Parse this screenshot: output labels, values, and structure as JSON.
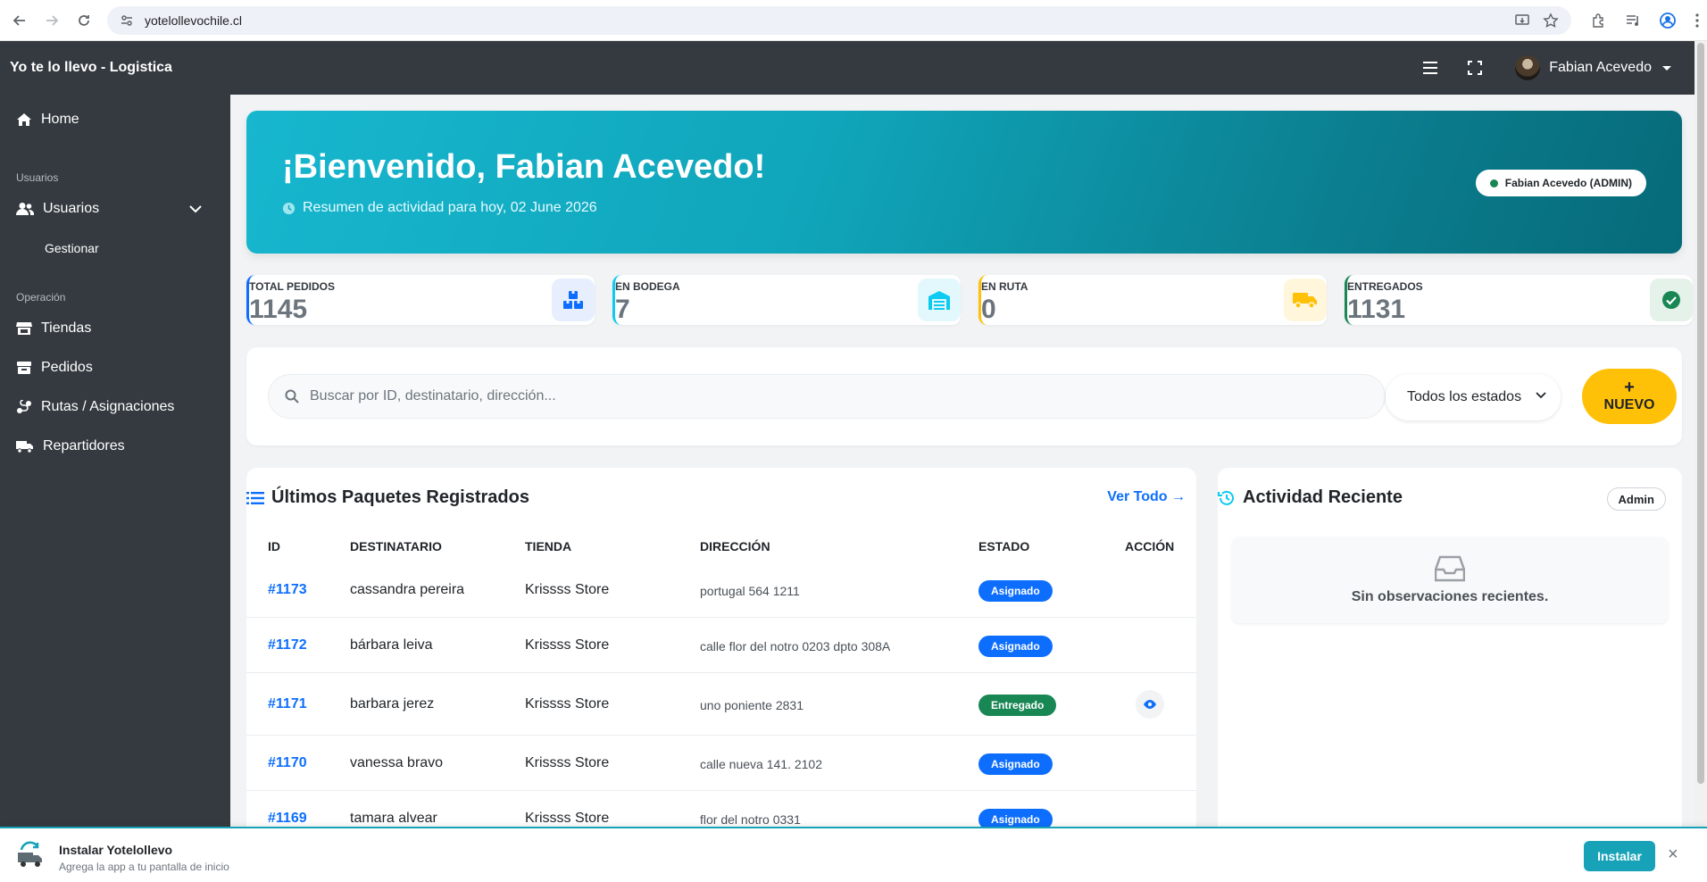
{
  "browser": {
    "url": "yotelollevochile.cl"
  },
  "app": {
    "brand": "Yo te lo llevo - Logistica",
    "user_name": "Fabian Acevedo"
  },
  "sidebar": {
    "home": "Home",
    "section_users": "Usuarios",
    "users": "Usuarios",
    "manage": "Gestionar",
    "section_ops": "Operación",
    "stores": "Tiendas",
    "orders": "Pedidos",
    "routes": "Rutas / Asignaciones",
    "drivers": "Repartidores"
  },
  "hero": {
    "title": "¡Bienvenido, Fabian Acevedo!",
    "subtitle": "Resumen de actividad para hoy, 02 June 2026",
    "role_badge": "Fabian Acevedo (ADMIN)"
  },
  "stats": [
    {
      "label": "TOTAL PEDIDOS",
      "value": "1145",
      "color": "#0d6efd",
      "icon": "boxes-icon"
    },
    {
      "label": "EN BODEGA",
      "value": "7",
      "color": "#0dcaf0",
      "icon": "warehouse-icon"
    },
    {
      "label": "EN RUTA",
      "value": "0",
      "color": "#ffc107",
      "icon": "truck-icon"
    },
    {
      "label": "ENTREGADOS",
      "value": "1131",
      "color": "#198754",
      "icon": "check-circle-icon"
    }
  ],
  "search": {
    "placeholder": "Buscar por ID, destinatario, dirección...",
    "status_filter": "Todos los estados",
    "new_plus": "+",
    "new_label": "NUEVO"
  },
  "packages": {
    "title": "Últimos Paquetes Registrados",
    "view_all": "Ver Todo →",
    "columns": [
      "ID",
      "DESTINATARIO",
      "TIENDA",
      "DIRECCIÓN",
      "ESTADO",
      "ACCIÓN"
    ],
    "rows": [
      {
        "id": "#1173",
        "recipient": "cassandra pereira",
        "store": "Krissss Store",
        "address": "portugal 564 1211",
        "status": "Asignado"
      },
      {
        "id": "#1172",
        "recipient": "bárbara leiva",
        "store": "Krissss Store",
        "address": "calle flor del notro 0203 dpto 308A",
        "status": "Asignado"
      },
      {
        "id": "#1171",
        "recipient": "barbara jerez",
        "store": "Krissss Store",
        "address": "uno poniente 2831",
        "status": "Entregado"
      },
      {
        "id": "#1170",
        "recipient": "vanessa bravo",
        "store": "Krissss Store",
        "address": "calle nueva 141. 2102",
        "status": "Asignado"
      },
      {
        "id": "#1169",
        "recipient": "tamara alvear",
        "store": "Krissss Store",
        "address": "flor del notro 0331",
        "status": "Asignado"
      }
    ]
  },
  "activity": {
    "title": "Actividad Reciente",
    "admin_label": "Admin",
    "empty_text": "Sin observaciones recientes."
  },
  "install": {
    "title": "Instalar Yotelollevo",
    "subtitle": "Agrega la app a tu pantalla de inicio",
    "button": "Instalar",
    "close": "×"
  },
  "colors": {
    "assigned": "#0d6efd",
    "delivered": "#198754"
  }
}
